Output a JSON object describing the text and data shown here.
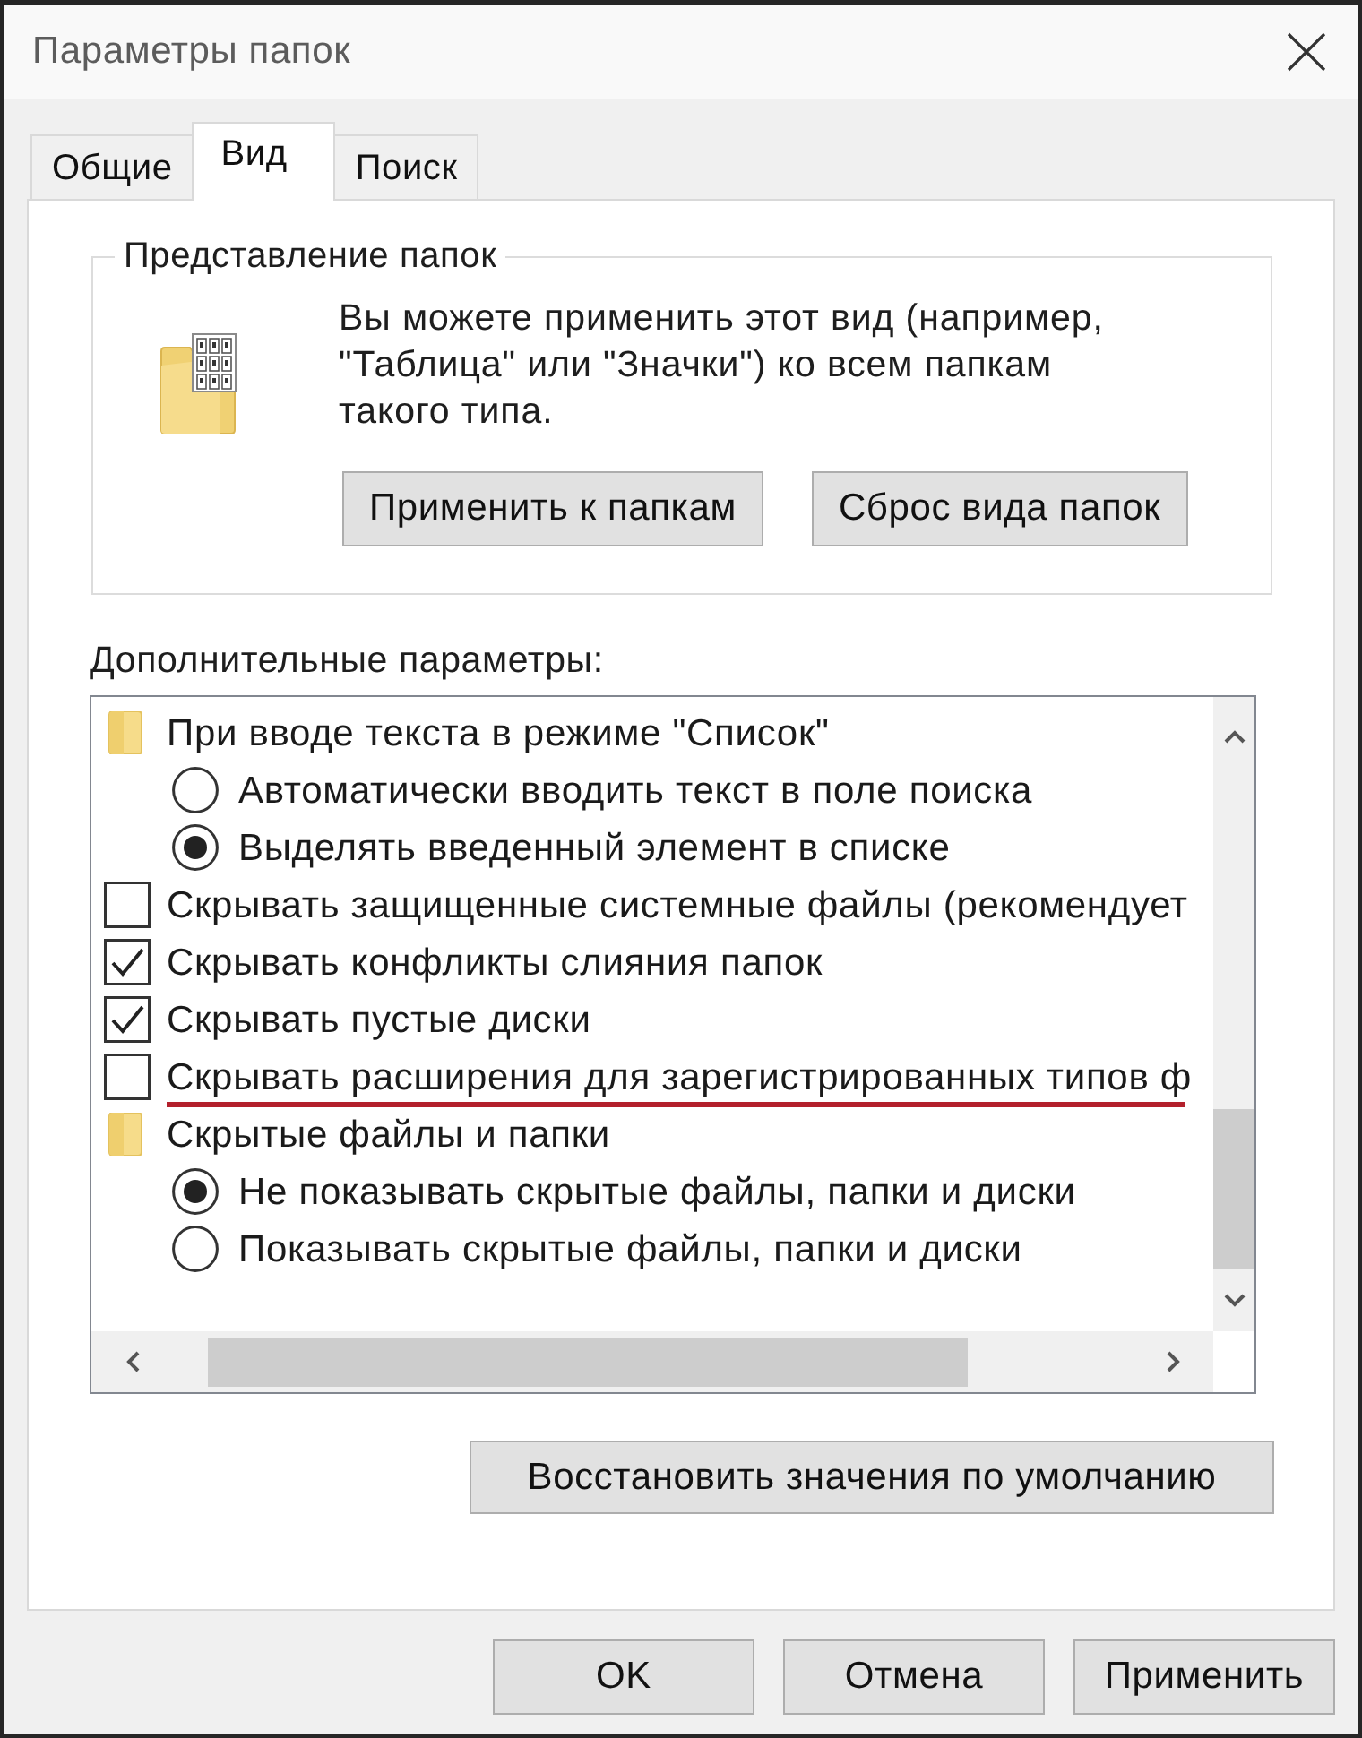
{
  "window": {
    "title": "Параметры папок"
  },
  "tabs": [
    {
      "label": "Общие",
      "selected": false
    },
    {
      "label": "Вид",
      "selected": true
    },
    {
      "label": "Поиск",
      "selected": false
    }
  ],
  "folder_views": {
    "title": "Представление папок",
    "description": "Вы можете применить этот вид (например,\n\"Таблица\" или \"Значки\") ко всем папкам\nтакого типа.",
    "buttons": [
      "Применить к папкам",
      "Сброс вида папок"
    ]
  },
  "advanced": {
    "label": "Дополнительные параметры:",
    "items": [
      {
        "kind": "folder",
        "label": "При вводе текста в режиме \"Список\"",
        "underlined": false,
        "children": [
          {
            "kind": "radio",
            "label": "Автоматически вводить текст в поле поиска",
            "selected": false,
            "underlined": false
          },
          {
            "kind": "radio",
            "label": "Выделять введенный элемент в списке",
            "selected": true,
            "underlined": false
          }
        ]
      },
      {
        "kind": "checkbox",
        "label": "Скрывать защищенные системные файлы (рекомендует",
        "checked": false,
        "underlined": false
      },
      {
        "kind": "checkbox",
        "label": "Скрывать конфликты слияния папок",
        "checked": true,
        "underlined": false
      },
      {
        "kind": "checkbox",
        "label": "Скрывать пустые диски",
        "checked": true,
        "underlined": false
      },
      {
        "kind": "checkbox",
        "label": "Скрывать расширения для зарегистрированных типов ф",
        "checked": false,
        "underlined": true
      },
      {
        "kind": "folder",
        "label": "Скрытые файлы и папки",
        "underlined": false,
        "children": [
          {
            "kind": "radio",
            "label": "Не показывать скрытые файлы, папки и диски",
            "selected": true,
            "underlined": false
          },
          {
            "kind": "radio",
            "label": "Показывать скрытые файлы, папки и диски",
            "selected": false,
            "underlined": false
          }
        ]
      }
    ],
    "restore_button": "Восстановить значения по умолчанию"
  },
  "buttons": [
    "OK",
    "Отмена",
    "Применить"
  ]
}
